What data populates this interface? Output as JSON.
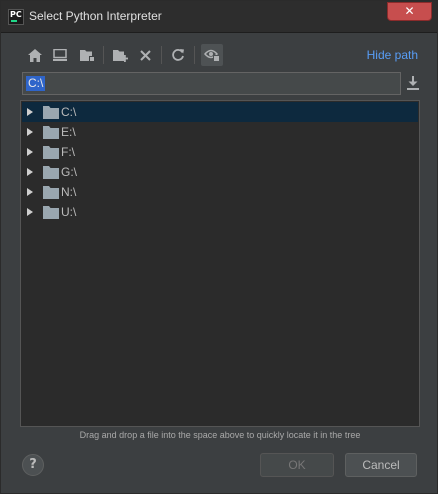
{
  "window": {
    "title": "Select Python Interpreter",
    "app_icon_text": "PC",
    "close_glyph": "✕"
  },
  "toolbar": {
    "icons": [
      "home-icon",
      "desktop-icon",
      "project-folder-icon",
      "new-folder-icon",
      "delete-icon",
      "refresh-icon",
      "show-hidden-icon"
    ],
    "hide_path_label": "Hide path"
  },
  "path": {
    "value": "C:\\"
  },
  "tree": {
    "items": [
      {
        "label": "C:\\",
        "selected": true
      },
      {
        "label": "E:\\",
        "selected": false
      },
      {
        "label": "F:\\",
        "selected": false
      },
      {
        "label": "G:\\",
        "selected": false
      },
      {
        "label": "N:\\",
        "selected": false
      },
      {
        "label": "U:\\",
        "selected": false
      }
    ]
  },
  "hint": "Drag and drop a file into the space above to quickly locate it in the tree",
  "buttons": {
    "help": "?",
    "ok": "OK",
    "cancel": "Cancel"
  },
  "colors": {
    "background": "#3c3f41",
    "tree_background": "#2b2b2b",
    "selection": "#0d293e",
    "link": "#589df6",
    "text_selection": "#2f65ca"
  }
}
